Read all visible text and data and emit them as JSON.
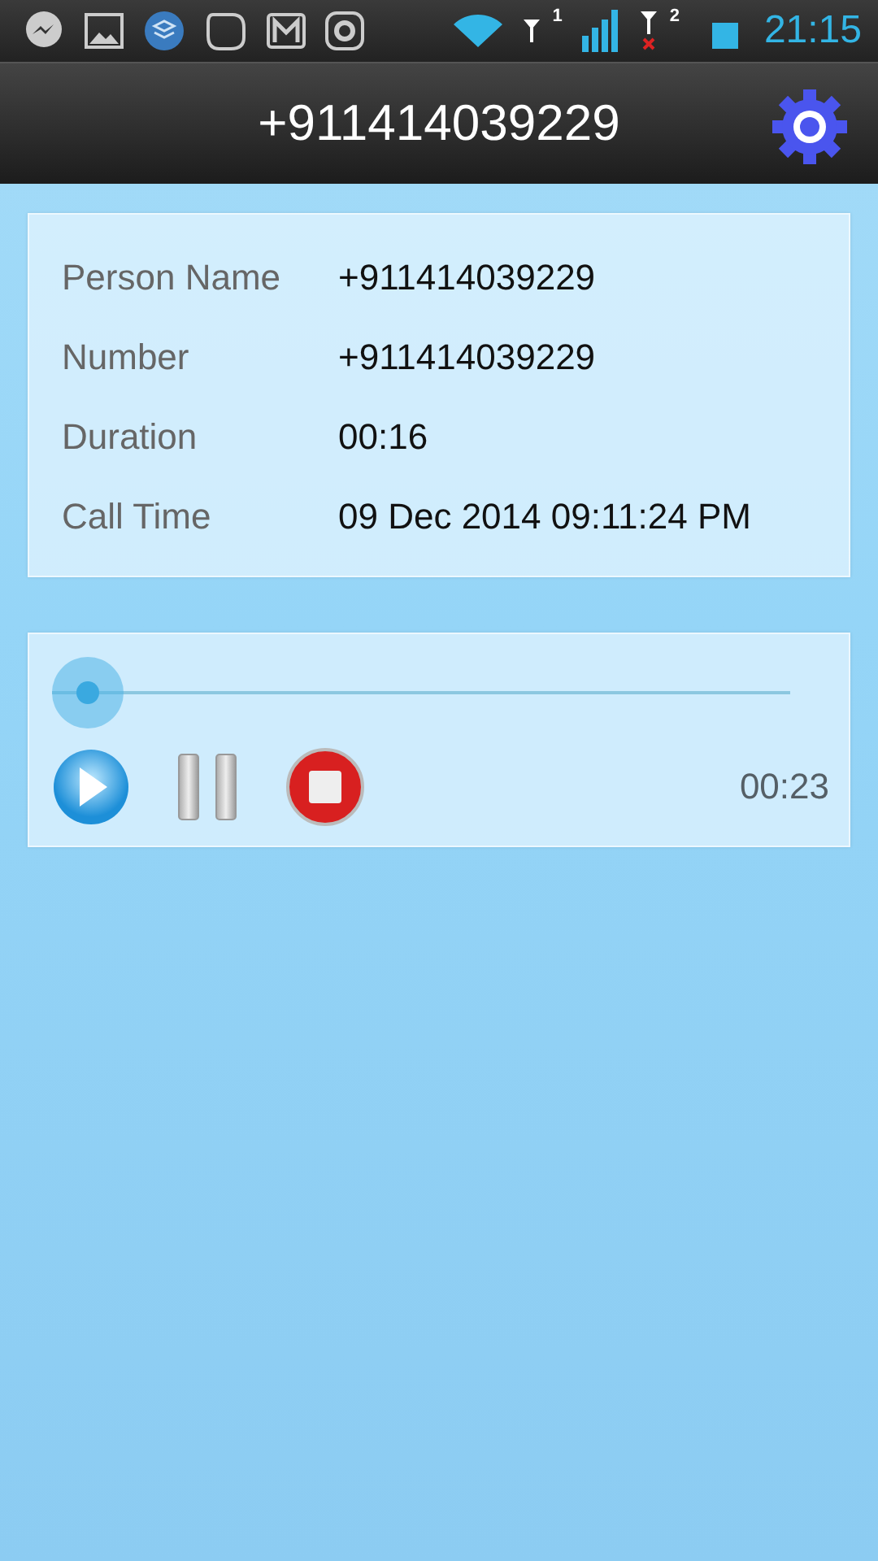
{
  "status_bar": {
    "sim_labels": [
      "1",
      "2"
    ],
    "time": "21:15"
  },
  "app_bar": {
    "title": "+911414039229"
  },
  "details": [
    {
      "label": "Person Name",
      "value": "+911414039229"
    },
    {
      "label": "Number",
      "value": "+911414039229"
    },
    {
      "label": "Duration",
      "value": "00:16"
    },
    {
      "label": "Call Time",
      "value": "09 Dec 2014 09:11:24 PM"
    }
  ],
  "player": {
    "level": 0,
    "time": "00:23"
  }
}
